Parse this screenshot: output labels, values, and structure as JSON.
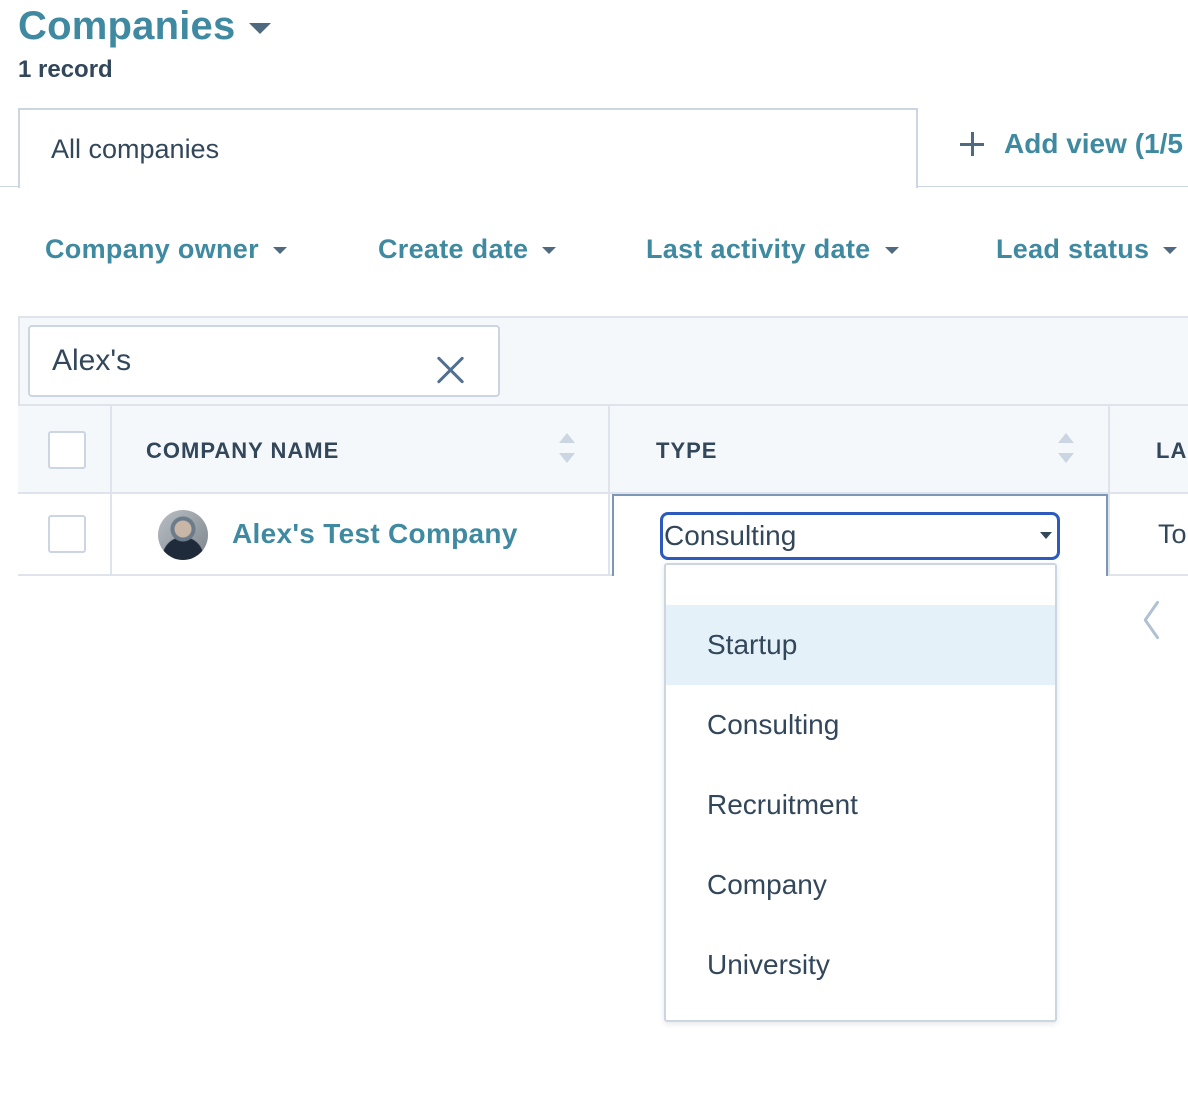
{
  "header": {
    "title": "Companies",
    "record_count": "1 record"
  },
  "tabs": {
    "active_label": "All companies",
    "add_view_label": "Add view (1/5"
  },
  "filters": [
    {
      "label": "Company owner"
    },
    {
      "label": "Create date"
    },
    {
      "label": "Last activity date"
    },
    {
      "label": "Lead status"
    }
  ],
  "search": {
    "value": "Alex's"
  },
  "table": {
    "columns": [
      "COMPANY NAME",
      "TYPE",
      "LA"
    ],
    "rows": [
      {
        "company_name": "Alex's Test Company",
        "type": "Consulting",
        "last_col_preview": "To"
      }
    ]
  },
  "type_dropdown": {
    "selected": "Consulting",
    "options": [
      "",
      "Startup",
      "Consulting",
      "Recruitment",
      "Company",
      "University"
    ],
    "hovered": "Startup"
  },
  "colors": {
    "accent": "#3f8aa1",
    "text": "#33475b",
    "border": "#cbd6e2",
    "focus": "#2d5bbd",
    "hover": "#e5f1f8"
  }
}
